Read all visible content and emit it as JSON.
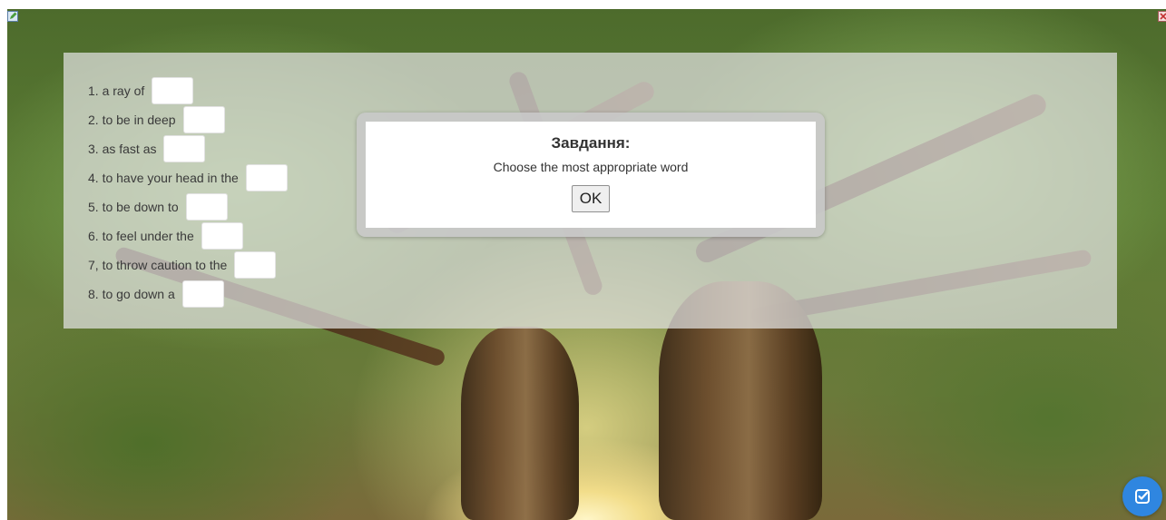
{
  "exercise": {
    "items": [
      {
        "label": "1. a ray of",
        "answer": ""
      },
      {
        "label": "2. to be in deep",
        "answer": ""
      },
      {
        "label": "3. as fast as",
        "answer": ""
      },
      {
        "label": "4. to have your head in the",
        "answer": ""
      },
      {
        "label": "5. to be down to",
        "answer": ""
      },
      {
        "label": "6. to feel under the",
        "answer": ""
      },
      {
        "label": "7, to throw caution to the",
        "answer": ""
      },
      {
        "label": "8. to go down a",
        "answer": ""
      }
    ]
  },
  "dialog": {
    "title": "Завдання:",
    "message": "Choose the most appropriate word",
    "ok_label": "OK"
  },
  "icons": {
    "top_left": "edit-icon",
    "top_right": "close-icon",
    "fab": "check-icon"
  },
  "colors": {
    "fab": "#2f86e0",
    "overlay": "#e2e2e2"
  }
}
